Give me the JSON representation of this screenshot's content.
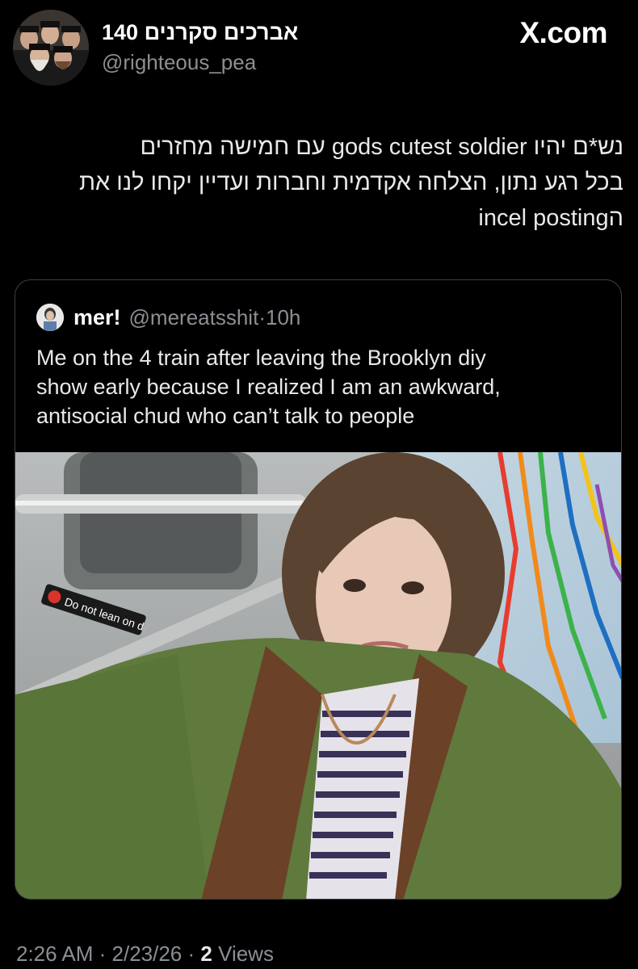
{
  "header": {
    "display_name": "אברכים סקרנים 140",
    "handle": "@righteous_pea",
    "brand": "X.com"
  },
  "tweet": {
    "lines": [
      "נש*ם יהיו gods cutest soldier עם חמישה מחזרים",
      "בכל רגע נתון, הצלחה אקדמית וחברות ועדיין יקחו לנו את",
      "הincel posting"
    ]
  },
  "quote": {
    "name": "mer!",
    "handle": "@mereatsshit",
    "separator": "·",
    "time": "10h",
    "lines": [
      "Me on the 4 train after leaving the Brooklyn diy",
      "show early because I realized I am an awkward,",
      "antisocial chud who can’t talk to people"
    ],
    "photo": {
      "sticker_text": "Do not lean on d"
    }
  },
  "footer": {
    "time": "2:26 AM",
    "sep1": " · ",
    "date": "2/23/26",
    "sep2": " · ",
    "views_count": "2",
    "views_label": " Views"
  },
  "colors": {
    "background": "#000000",
    "text_primary": "#e7e9ea",
    "text_secondary": "#8b8f94",
    "card_border": "#3b4045"
  }
}
